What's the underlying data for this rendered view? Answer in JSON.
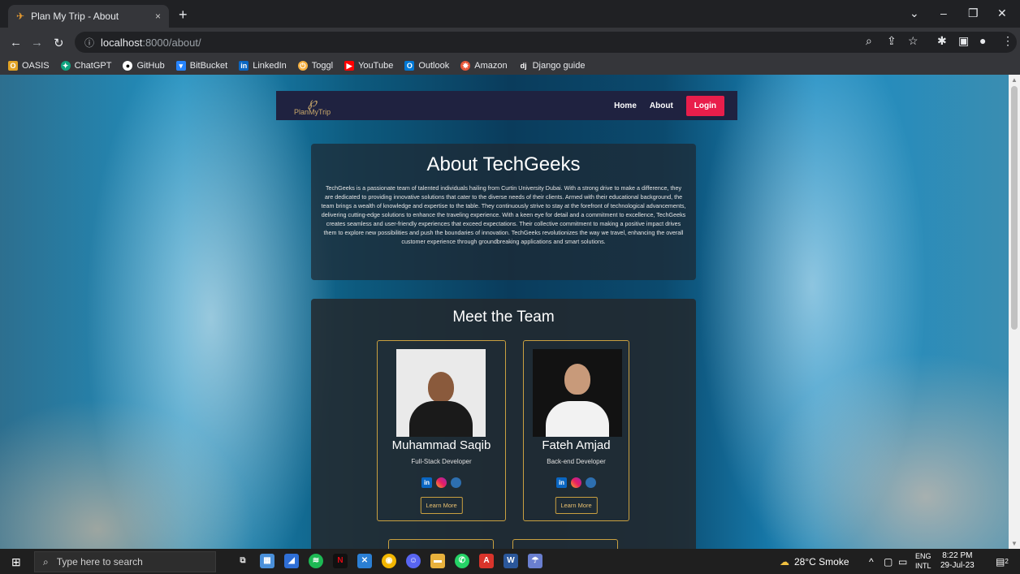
{
  "browser": {
    "tab_title": "Plan My Trip - About",
    "tab_close": "×",
    "new_tab": "+",
    "url_host": "localhost",
    "url_path": ":8000/about/",
    "bookmarks": [
      "OASIS",
      "ChatGPT",
      "GitHub",
      "BitBucket",
      "LinkedIn",
      "Toggl",
      "YouTube",
      "Outlook",
      "Amazon",
      "Django guide"
    ]
  },
  "site": {
    "logo_text": "PlanMyTrip",
    "nav": {
      "home": "Home",
      "about": "About",
      "login": "Login"
    },
    "about": {
      "title": "About TechGeeks",
      "body": "TechGeeks is a passionate team of talented individuals hailing from Curtin University Dubai. With a strong drive to make a difference, they are dedicated to providing innovative solutions that cater to the diverse needs of their clients. Armed with their educational background, the team brings a wealth of knowledge and expertise to the table. They continuously strive to stay at the forefront of technological advancements, delivering cutting-edge solutions to enhance the traveling experience. With a keen eye for detail and a commitment to excellence, TechGeeks creates seamless and user-friendly experiences that exceed expectations. Their collective commitment to making a positive impact drives them to explore new possibilities and push the boundaries of innovation. TechGeeks revolutionizes the way we travel, enhancing the overall customer experience through groundbreaking applications and smart solutions."
    },
    "team": {
      "title": "Meet the Team",
      "members": [
        {
          "name": "Muhammad Saqib",
          "role": "Full-Stack Developer",
          "button": "Learn More"
        },
        {
          "name": "Fateh Amjad",
          "role": "Back-end Developer",
          "button": "Learn More"
        }
      ]
    }
  },
  "taskbar": {
    "search_placeholder": "Type here to search",
    "weather": "28°C Smoke",
    "lang_top": "ENG",
    "lang_bottom": "INTL",
    "time": "8:22 PM",
    "date": "29-Jul-23",
    "notifications": "2"
  }
}
